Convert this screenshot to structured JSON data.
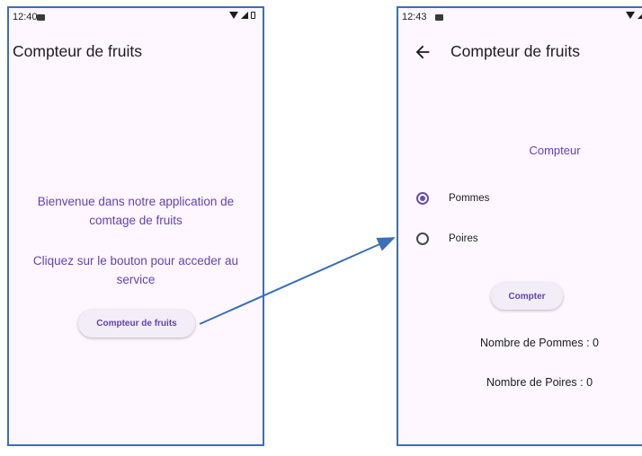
{
  "screen1": {
    "status_time": "12:40",
    "title": "Compteur de fruits",
    "welcome_line1": "Bienvenue dans notre application de",
    "welcome_line2": "comtage de fruits",
    "instruction_line1": "Cliquez sur le bouton pour acceder au",
    "instruction_line2": "service",
    "button_label": "Compteur de fruits"
  },
  "screen2": {
    "status_time": "12:43",
    "title": "Compteur de fruits",
    "section_label": "Compteur",
    "options": [
      {
        "label": "Pommes",
        "selected": true
      },
      {
        "label": "Poires",
        "selected": false
      }
    ],
    "button_label": "Compter",
    "pommes_count": "Nombre de Pommes : 0",
    "poires_count": "Nombre de Poires : 0"
  },
  "colors": {
    "accent": "#6750a4",
    "text_purple": "#6441b4",
    "frame_border": "#3b6fb6",
    "screen_bg": "#fef7ff"
  },
  "icons": [
    "image-icon",
    "wifi-icon",
    "signal-icon",
    "battery-icon",
    "back-arrow-icon",
    "radio-icon",
    "flow-arrow-icon"
  ]
}
